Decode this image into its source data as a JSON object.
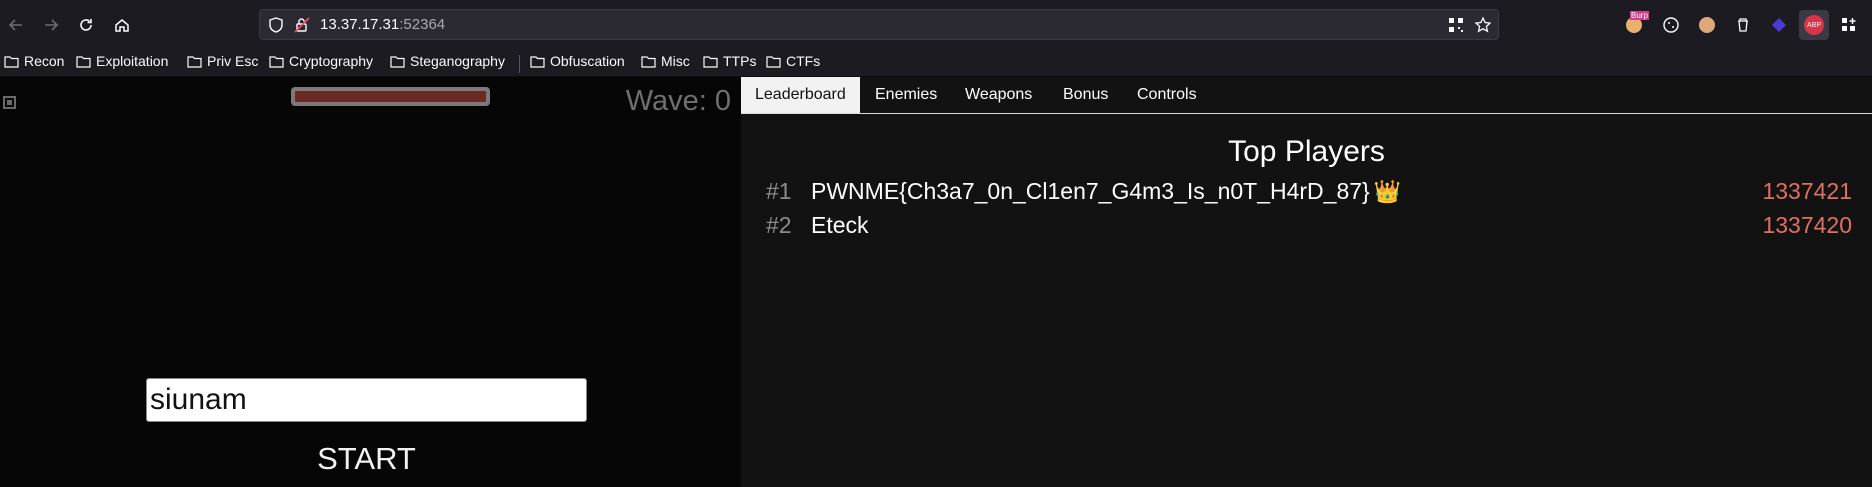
{
  "browser": {
    "url_host": "13.37.17.31",
    "url_port": ":52364",
    "extensions": [
      "burp-icon",
      "cookie-icon",
      "glasses-icon",
      "trash-icon",
      "diamond-icon",
      "abp-icon",
      "grid-add-icon"
    ],
    "abp_label": "ABP",
    "burp_label": "Burp"
  },
  "bookmarks": [
    {
      "label": "Recon"
    },
    {
      "label": "Exploitation"
    },
    {
      "label": "Priv Esc"
    },
    {
      "label": "Cryptography"
    },
    {
      "label": "Steganography"
    },
    {
      "label": "Obfuscation"
    },
    {
      "label": "Misc"
    },
    {
      "label": "TTPs"
    },
    {
      "label": "CTFs"
    }
  ],
  "game": {
    "wave_label": "Wave: 0",
    "health_fraction": 1.0,
    "name_value": "siunam",
    "start_label": "START"
  },
  "panel": {
    "tabs": [
      {
        "label": "Leaderboard",
        "active": true
      },
      {
        "label": "Enemies",
        "active": false
      },
      {
        "label": "Weapons",
        "active": false
      },
      {
        "label": "Bonus",
        "active": false
      },
      {
        "label": "Controls",
        "active": false
      }
    ],
    "title": "Top Players",
    "players": [
      {
        "rank": "#1",
        "name": "PWNME{Ch3a7_0n_Cl1en7_G4m3_Is_n0T_H4rD_87}",
        "badge": "👑",
        "score": "1337421"
      },
      {
        "rank": "#2",
        "name": "Eteck",
        "badge": "",
        "score": "1337420"
      }
    ]
  }
}
